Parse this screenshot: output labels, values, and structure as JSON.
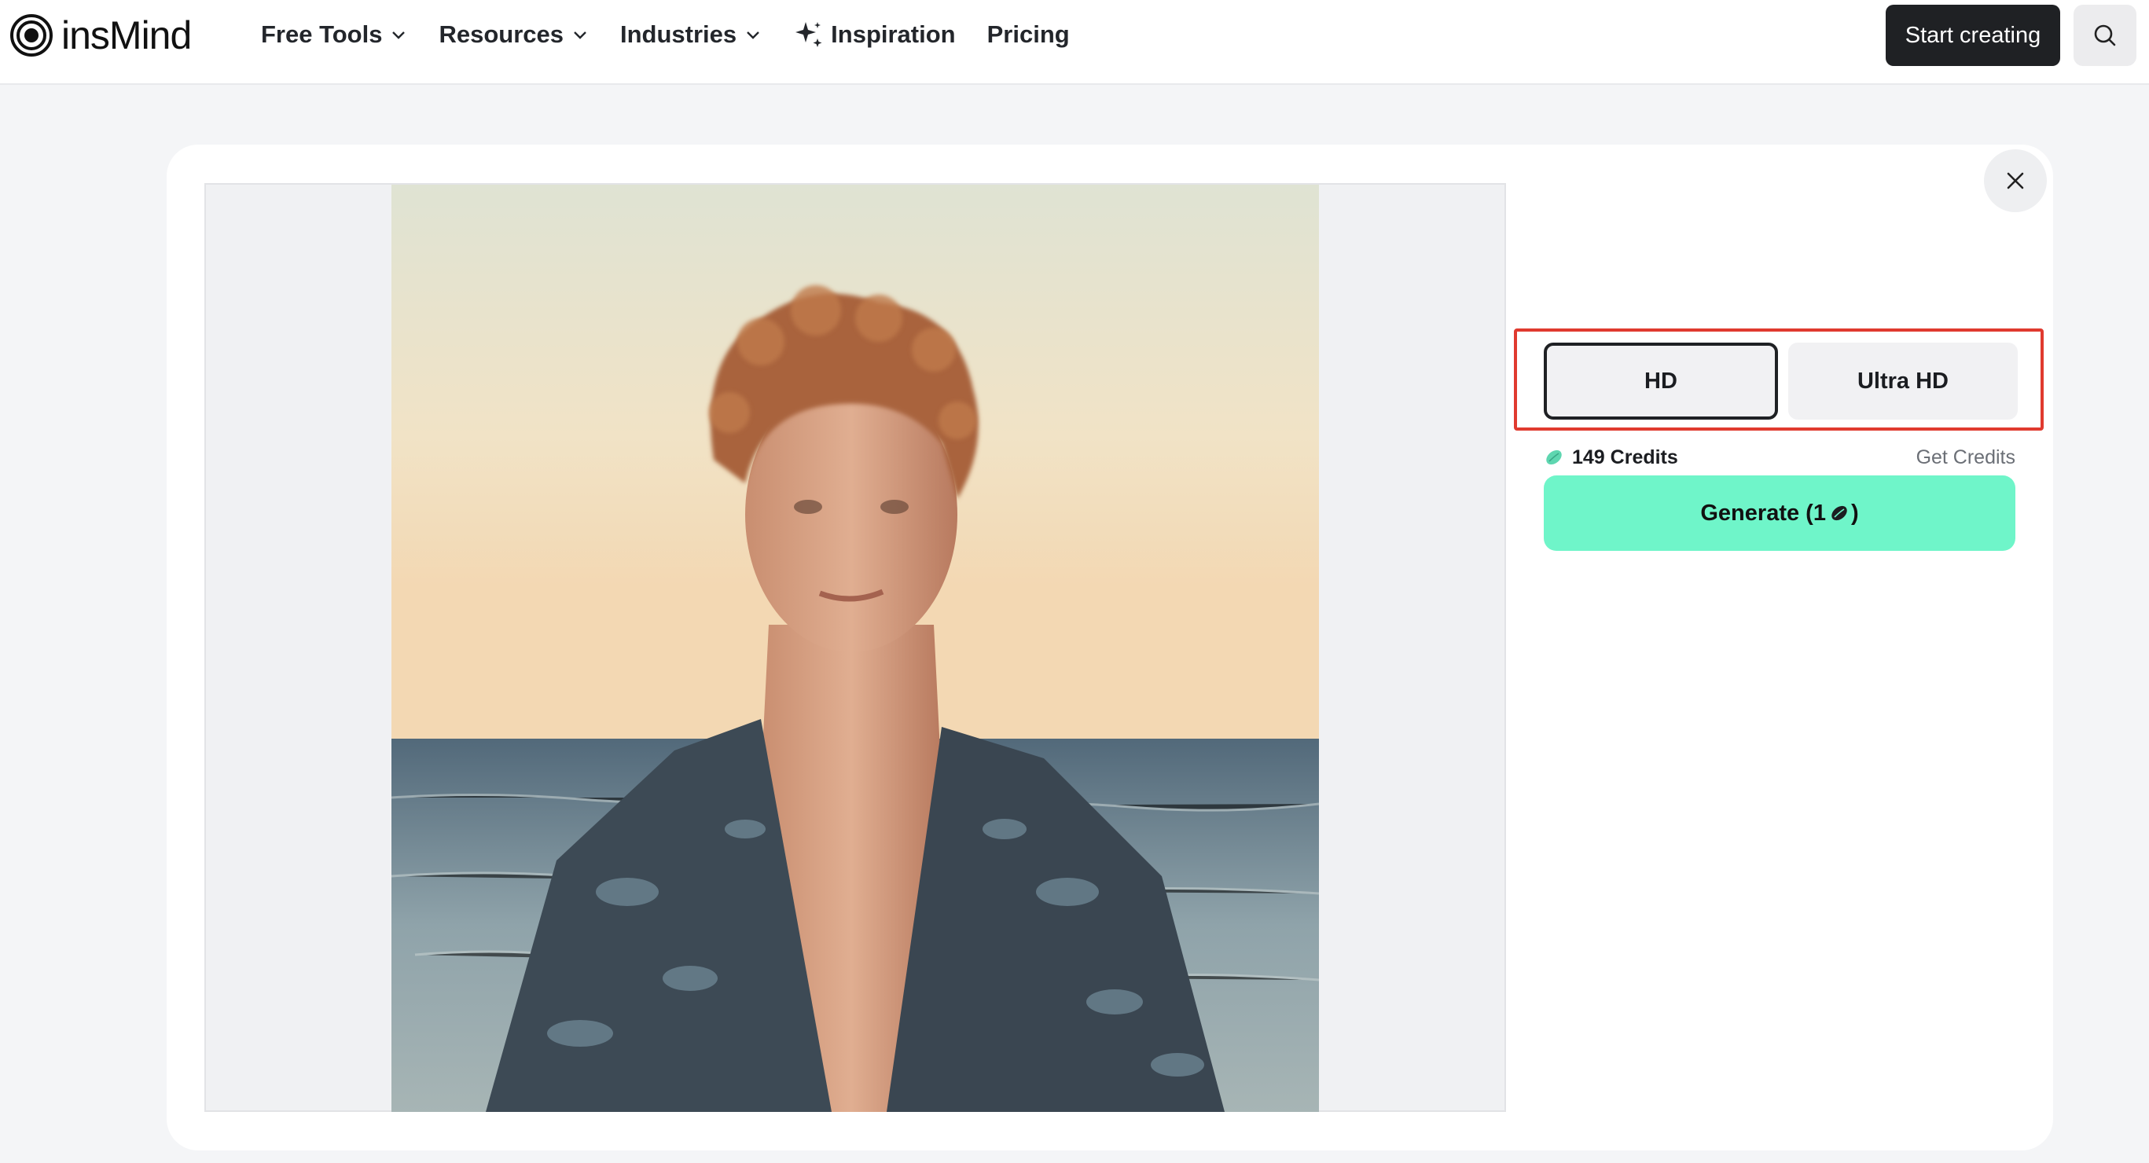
{
  "header": {
    "logo_text": "insMind",
    "nav": [
      {
        "label": "Free Tools",
        "has_dropdown": true
      },
      {
        "label": "Resources",
        "has_dropdown": true
      },
      {
        "label": "Industries",
        "has_dropdown": true
      },
      {
        "label": "Inspiration",
        "icon": "sparkle-icon"
      },
      {
        "label": "Pricing"
      }
    ],
    "start_button": "Start creating",
    "search_icon": "search-icon"
  },
  "modal": {
    "close_icon": "close-icon",
    "quality_options": [
      {
        "label": "HD",
        "selected": true
      },
      {
        "label": "Ultra HD",
        "selected": false
      }
    ],
    "credits": {
      "amount_label": "149 Credits",
      "get_credits_label": "Get Credits",
      "icon": "credit-bean-icon"
    },
    "generate": {
      "label_prefix": "Generate (1",
      "label_suffix": ")",
      "icon": "credit-bean-icon"
    }
  },
  "colors": {
    "accent_generate": "#6ff5c9",
    "highlight_border": "#e03a2f",
    "dark_button": "#1f2124"
  }
}
